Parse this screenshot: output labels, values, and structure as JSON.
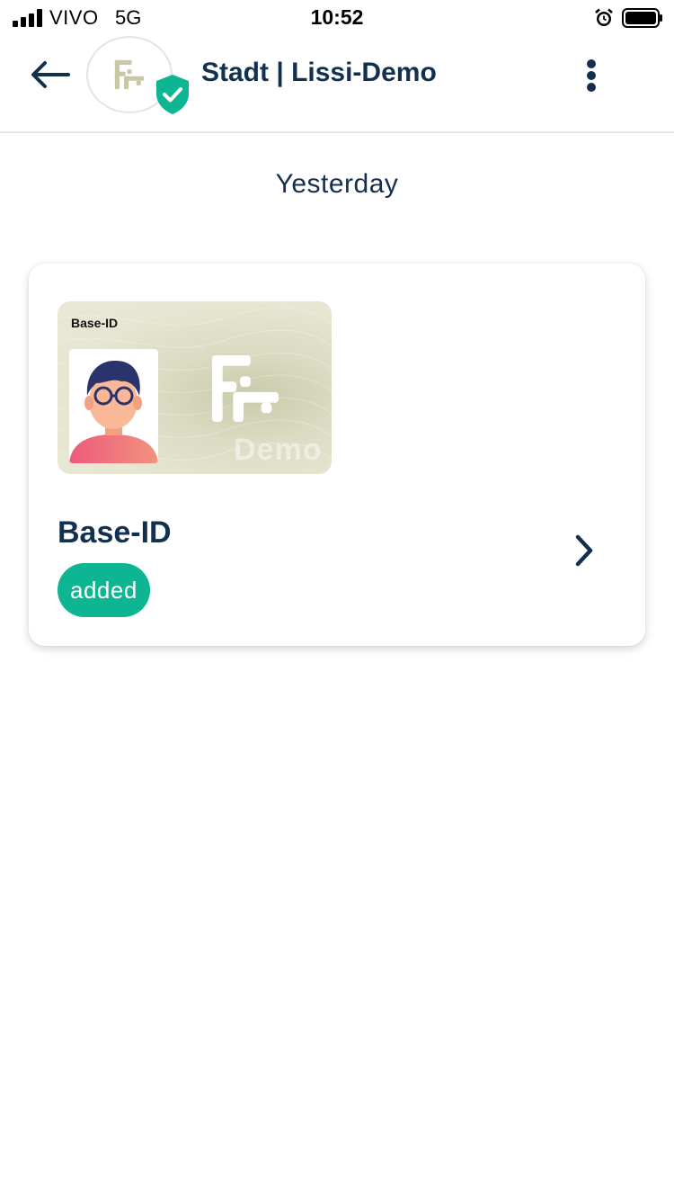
{
  "status_bar": {
    "carrier": "VIVO",
    "network": "5G",
    "time": "10:52",
    "icons": [
      "signal-icon",
      "alarm-icon",
      "battery-icon"
    ]
  },
  "header": {
    "title": "Stadt | Lissi-Demo",
    "icons": [
      "back-arrow-icon",
      "verified-shield-icon",
      "more-vertical-icon"
    ]
  },
  "history": {
    "date_label": "Yesterday"
  },
  "credential": {
    "card_label": "Base-ID",
    "card_watermark": "Demo",
    "title": "Base-ID",
    "status": "added",
    "icons": [
      "chevron-right-icon"
    ]
  },
  "colors": {
    "text_primary": "#14304f",
    "accent_green": "#0db592",
    "id_card_background": "#e6e6d2",
    "divider": "#e6e6e6"
  }
}
